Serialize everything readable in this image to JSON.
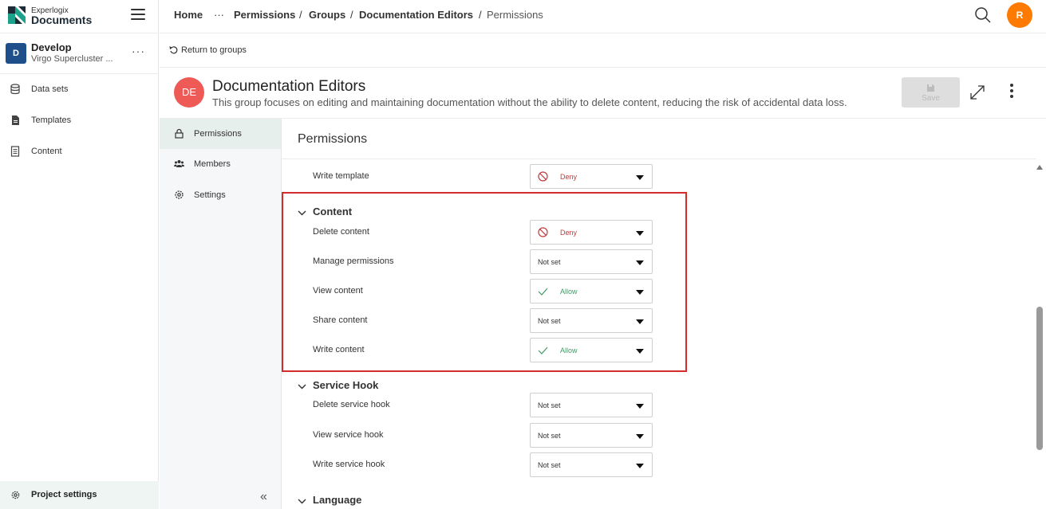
{
  "brand": {
    "small": "Experlogix",
    "big": "Documents"
  },
  "project": {
    "badge": "D",
    "name": "Develop",
    "subtitle": "Virgo Supercluster ...",
    "more": "···"
  },
  "sidebar": {
    "items": [
      {
        "label": "Data sets",
        "icon": "database-icon"
      },
      {
        "label": "Templates",
        "icon": "file-icon"
      },
      {
        "label": "Content",
        "icon": "document-icon"
      }
    ],
    "footer": {
      "label": "Project settings",
      "icon": "gear-icon"
    }
  },
  "breadcrumb": {
    "home": "Home",
    "ellipsis": "···",
    "items": [
      "Permissions",
      "Groups",
      "Documentation Editors",
      "Permissions"
    ],
    "separator": "/"
  },
  "user": {
    "initial": "R",
    "color": "#ff7a00"
  },
  "return_label": "Return to groups",
  "group": {
    "initials": "DE",
    "color": "#ee5a55",
    "title": "Documentation Editors",
    "description": "This group focuses on editing and maintaining documentation without the ability to delete content, reducing the risk of accidental data loss.",
    "save_label": "Save"
  },
  "subnav": {
    "items": [
      {
        "label": "Permissions",
        "icon": "lock-icon",
        "active": true
      },
      {
        "label": "Members",
        "icon": "users-icon",
        "active": false
      },
      {
        "label": "Settings",
        "icon": "gear-icon",
        "active": false
      }
    ],
    "collapse": "«"
  },
  "content": {
    "title": "Permissions",
    "top_row": {
      "label": "Write template",
      "value": "Deny"
    },
    "sections": [
      {
        "title": "Content",
        "rows": [
          {
            "label": "Delete content",
            "value": "Deny"
          },
          {
            "label": "Manage permissions",
            "value": "Not set"
          },
          {
            "label": "View content",
            "value": "Allow"
          },
          {
            "label": "Share content",
            "value": "Not set"
          },
          {
            "label": "Write content",
            "value": "Allow"
          }
        ]
      },
      {
        "title": "Service Hook",
        "rows": [
          {
            "label": "Delete service hook",
            "value": "Not set"
          },
          {
            "label": "View service hook",
            "value": "Not set"
          },
          {
            "label": "Write service hook",
            "value": "Not set"
          }
        ]
      },
      {
        "title": "Language",
        "rows": []
      }
    ]
  },
  "colors": {
    "deny": "#c23b3b",
    "allow": "#3f9a66",
    "highlight": "#d62b2b",
    "accent": "#1f4f8b"
  }
}
